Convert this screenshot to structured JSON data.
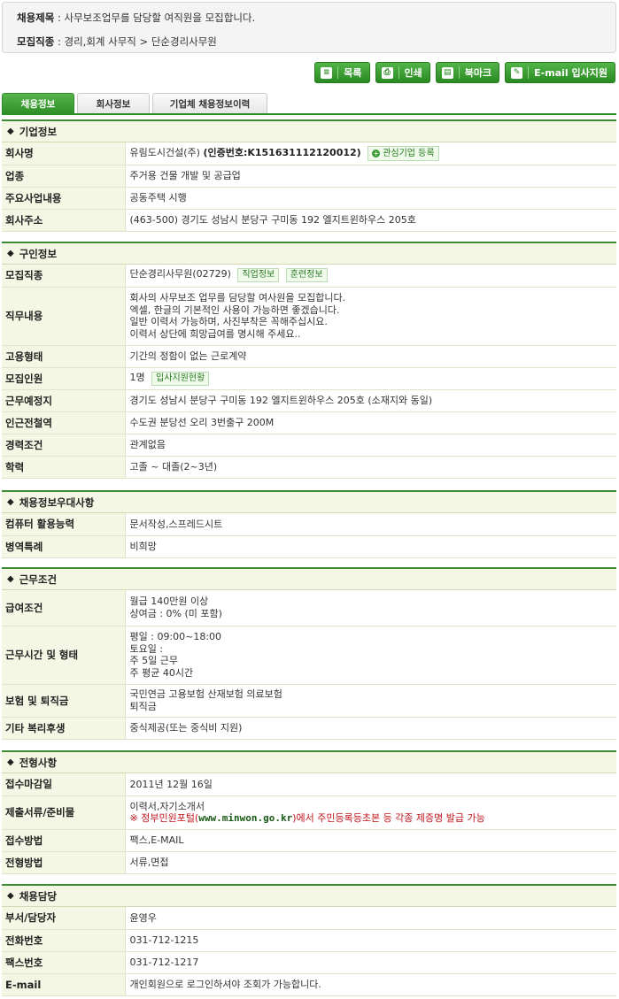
{
  "header": {
    "title_label": "채용제목",
    "title_value": "사무보조업무를 담당할 여직원을 모집합니다.",
    "category_label": "모집직종",
    "category_value": "경리,회계 사무직 > 단순경리사무원"
  },
  "toolbar": {
    "list_label": "목록",
    "print_label": "인쇄",
    "bookmark_label": "북마크",
    "email_apply_label": "E-mail 입사지원"
  },
  "tabs": [
    "채용정보",
    "회사정보",
    "기업체 채용정보이력"
  ],
  "company": {
    "heading": "기업정보",
    "name_label": "회사명",
    "name_value": "유림도시건설(주)",
    "cert_value": "(인증번호:K151631112120012)",
    "interest_button": "관심기업 등록",
    "industry_label": "업종",
    "industry_value": "주거용 건물 개발 및 공급업",
    "business_label": "주요사업내용",
    "business_value": "공동주택 시행",
    "address_label": "회사주소",
    "address_value": "(463-500) 경기도 성남시 분당구 구미동 192 엘지트윈하우스 205호"
  },
  "job": {
    "heading": "구인정보",
    "category_label": "모집직종",
    "category_value": "단순경리사무원(02729)",
    "job_info_tag": "직업정보",
    "training_tag": "훈련정보",
    "duty_label": "직무내용",
    "duty_lines": [
      "회사의 사무보조 업무를 담당할 여사원을 모집합니다.",
      "엑셀, 한글의 기본적인 사용이 가능하면 좋겠습니다.",
      "일반 이력서 가능하며, 사진부착은 꼭해주십시요.",
      "이력서 상단에 희망급여를 명시해 주세요.."
    ],
    "employment_label": "고용형태",
    "employment_value": "기간의 정함이 없는 근로계약",
    "headcount_label": "모집인원",
    "headcount_value": "1명",
    "applicants_tag": "입사지원현황",
    "workplace_label": "근무예정지",
    "workplace_value": "경기도 성남시 분당구 구미동 192 엘지트윈하우스 205호 (소재지와 동일)",
    "station_label": "인근전철역",
    "station_value": "수도권 분당선 오리 3번출구 200M",
    "experience_label": "경력조건",
    "experience_value": "관계없음",
    "education_label": "학력",
    "education_value": "고졸 ~ 대졸(2~3년)"
  },
  "preference": {
    "heading": "채용정보우대사항",
    "computer_label": "컴퓨터 활용능력",
    "computer_value": "문서작성,스프레드시트",
    "military_label": "병역특례",
    "military_value": "비희망"
  },
  "conditions": {
    "heading": "근무조건",
    "salary_label": "급여조건",
    "salary_lines": [
      "월급 140만원 이상",
      "상여금 : 0% (미 포함)"
    ],
    "hours_label": "근무시간 및 형태",
    "hours_lines": [
      "평일 : 09:00~18:00",
      "토요일 :",
      "주 5일 근무",
      "주 평균 40시간"
    ],
    "insurance_label": "보험 및 퇴직금",
    "insurance_lines": [
      "국민연금 고용보험 산재보험 의료보험",
      "퇴직금"
    ],
    "welfare_label": "기타 복리후생",
    "welfare_value": "중식제공(또는 중식비 지원)"
  },
  "selection": {
    "heading": "전형사항",
    "deadline_label": "접수마감일",
    "deadline_value": "2011년 12월 16일",
    "documents_label": "제출서류/준비물",
    "documents_value": "이력서,자기소개서",
    "note_prefix": "※ 정부민원포털(",
    "note_site": "www.minwon.go.kr",
    "note_suffix": ")에서 주민등록등초본 등 각종 제증명 발급 가능",
    "receipt_label": "접수방법",
    "receipt_value": "팩스,E-MAIL",
    "method_label": "전형방법",
    "method_value": "서류,면접"
  },
  "contact": {
    "heading": "채용담당",
    "person_label": "부서/담당자",
    "person_value": "윤영우",
    "phone_label": "전화번호",
    "phone_value": "031-712-1215",
    "fax_label": "팩스번호",
    "fax_value": "031-712-1217",
    "email_label": "E-mail",
    "email_value": "개인회원으로 로그인하셔야 조회가 가능합니다."
  },
  "colors": {
    "accent": "#2e8e27",
    "header_bg": "#f4f7e3",
    "notice": "#c0161c"
  }
}
